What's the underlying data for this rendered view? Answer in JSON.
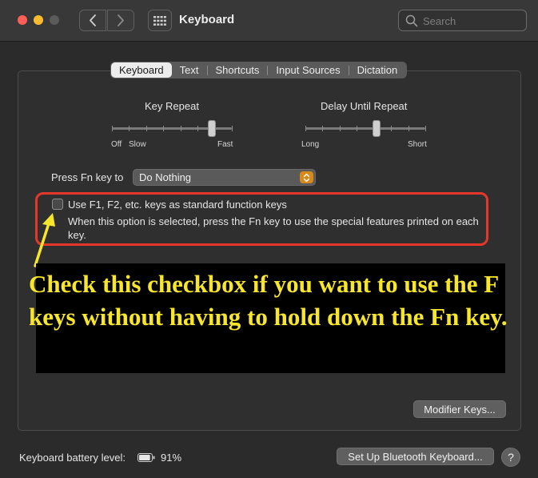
{
  "window": {
    "title": "Keyboard",
    "search_placeholder": "Search"
  },
  "tabs": [
    {
      "label": "Keyboard",
      "active": true
    },
    {
      "label": "Text",
      "active": false
    },
    {
      "label": "Shortcuts",
      "active": false
    },
    {
      "label": "Input Sources",
      "active": false
    },
    {
      "label": "Dictation",
      "active": false
    }
  ],
  "key_repeat": {
    "label": "Key Repeat",
    "left_labels": [
      "Off",
      "Slow"
    ],
    "right_label": "Fast",
    "level_fraction": 0.83
  },
  "delay_until_repeat": {
    "label": "Delay Until Repeat",
    "left_label": "Long",
    "right_label": "Short",
    "level_fraction": 0.59
  },
  "fn_key": {
    "label": "Press Fn key to",
    "selected": "Do Nothing"
  },
  "function_keys": {
    "checkbox_label": "Use F1, F2, etc. keys as standard function keys",
    "checked": false,
    "description": "When this option is selected, press the Fn key to use the special features printed on each key."
  },
  "annotation": {
    "text": "Check this checkbox if you want to use the F keys without having to hold down the Fn key.",
    "color": "#f7e62a",
    "outline_color": "#e4382b"
  },
  "buttons": {
    "modifier_keys": "Modifier Keys...",
    "bluetooth": "Set Up Bluetooth Keyboard...",
    "help": "?"
  },
  "battery": {
    "label": "Keyboard battery level:",
    "percent": "91%",
    "level_fraction": 0.91
  },
  "icons": {
    "back": "chevron-left-icon",
    "forward": "chevron-right-icon",
    "grid": "grid-icon",
    "search": "search-icon",
    "popup": "up-down-chevron-icon",
    "battery": "battery-icon"
  }
}
